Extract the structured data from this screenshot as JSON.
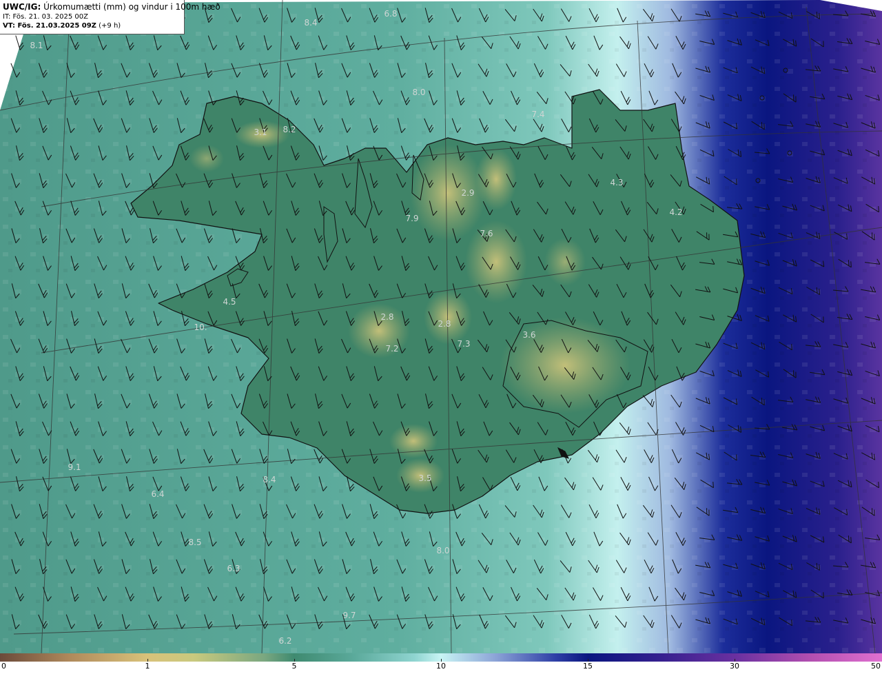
{
  "header": {
    "product_code": "UWC/IG:",
    "description": "Úrkomumætti (mm) og vindur i 100m hæð",
    "initial_time": "IT: Fös. 21. 03. 2025 00Z",
    "valid_label": "VT: Fös. 21.03.2025 09Z",
    "valid_offset": "(+9 h)"
  },
  "colorbar": {
    "ticks": [
      "0",
      "1",
      "5",
      "10",
      "15",
      "30",
      "50"
    ]
  },
  "value_labels": [
    "6.8",
    "8.4",
    "8.1",
    "8.0",
    "7.4",
    "3.1",
    "8.2",
    "2.9",
    "4.3",
    "4.2",
    "7.9",
    "7.6",
    "4.5",
    "2.8",
    "2.8",
    "10.",
    "7.2",
    "7.3",
    "3.6",
    "3.5",
    "9.1",
    "6.4",
    "8.4",
    "6.3",
    "6.2",
    "8.5",
    "9.7",
    "8.0"
  ],
  "colors": {
    "sea_light": "#5fb0a0",
    "land": "#3d8467",
    "highland": "#b7b56c",
    "cyan": "#c8f4f4",
    "deep_blue": "#0a1680",
    "purple": "#4d2f96",
    "coast_line": "#111111",
    "grid_line": "#333333",
    "barb": "#111111"
  }
}
